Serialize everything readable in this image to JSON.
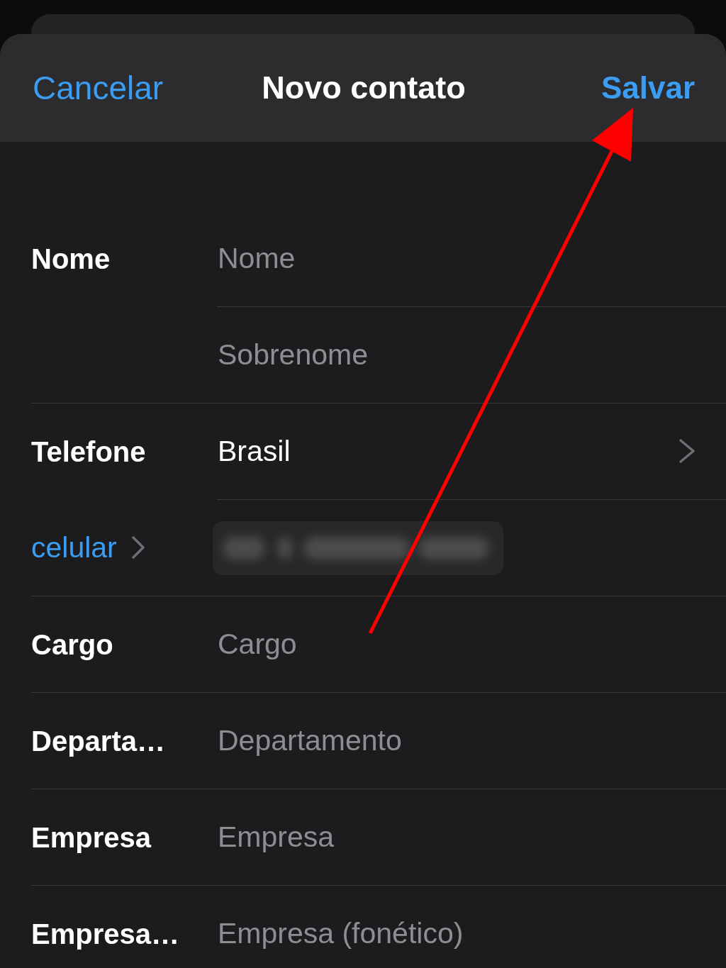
{
  "nav_bar": {
    "cancel_button": "Cancelar",
    "title": "Novo contato",
    "save_button": "Salvar"
  },
  "groups": [
    {
      "rows": [
        {
          "kind": "text",
          "label": "Nome",
          "placeholder": "Nome"
        },
        {
          "kind": "text",
          "placeholder": "Sobrenome"
        }
      ]
    },
    {
      "rows": [
        {
          "kind": "picker",
          "label": "Telefone",
          "value": "Brasil"
        },
        {
          "kind": "phone",
          "type_label": "celular"
        }
      ]
    },
    {
      "rows": [
        {
          "kind": "text",
          "label": "Cargo",
          "placeholder": "Cargo"
        }
      ]
    },
    {
      "rows": [
        {
          "kind": "text",
          "label": "Departa…",
          "placeholder": "Departamento"
        }
      ]
    },
    {
      "rows": [
        {
          "kind": "text",
          "label": "Empresa",
          "placeholder": "Empresa"
        }
      ]
    },
    {
      "rows": [
        {
          "kind": "text",
          "label": "Empresa…",
          "placeholder": "Empresa (fonético)"
        }
      ]
    }
  ]
}
